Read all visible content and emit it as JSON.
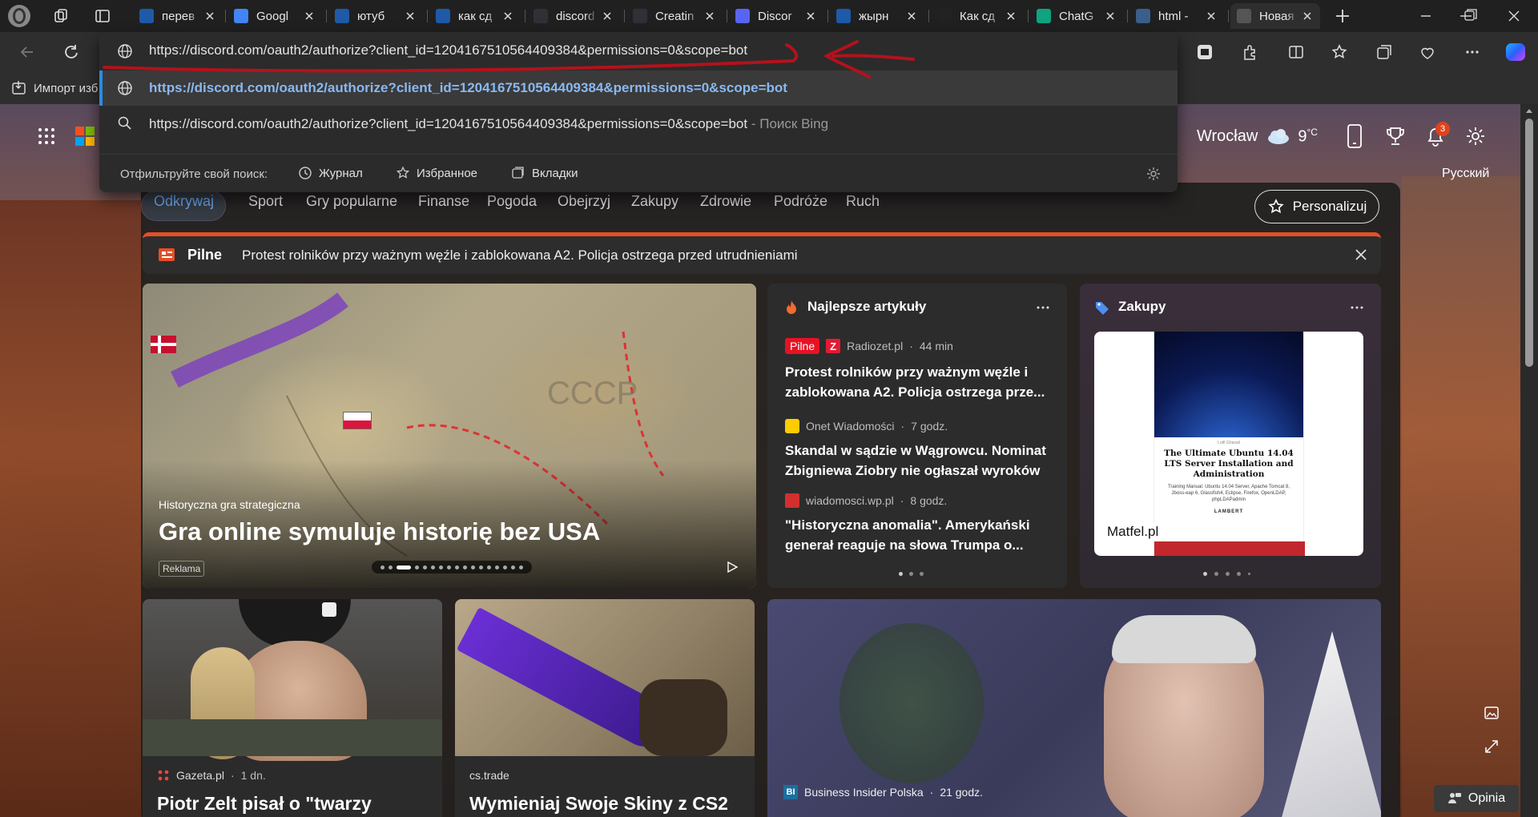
{
  "tabs": [
    {
      "label": "перев",
      "icon": "search-icon",
      "fav_color": "#1e5aa8"
    },
    {
      "label": "Googl",
      "icon": "google-translate-icon",
      "fav_color": "#4285f4"
    },
    {
      "label": "ютуб",
      "icon": "search-icon",
      "fav_color": "#1e5aa8"
    },
    {
      "label": "как сд",
      "icon": "search-icon",
      "fav_color": "#1e5aa8"
    },
    {
      "label": "discord",
      "icon": "discord-js-icon",
      "fav_color": "#2f3136"
    },
    {
      "label": "Creatin",
      "icon": "discord-js-icon",
      "fav_color": "#2f3136"
    },
    {
      "label": "Discor",
      "icon": "discord-icon",
      "fav_color": "#5865f2"
    },
    {
      "label": "жырн",
      "icon": "search-icon",
      "fav_color": "#1e5aa8"
    },
    {
      "label": "Как сд",
      "icon": "d-logo-icon",
      "fav_color": "#222"
    },
    {
      "label": "ChatG",
      "icon": "chatgpt-icon",
      "fav_color": "#10a37f"
    },
    {
      "label": "html -",
      "icon": "stackoverflow-icon",
      "fav_color": "#3a5f8a"
    },
    {
      "label": "Новая",
      "icon": "new-tab-icon",
      "fav_color": "#555"
    }
  ],
  "omnibox": {
    "url": "https://discord.com/oauth2/authorize?client_id=1204167510564409384&permissions=0&scope=bot",
    "suggestion_url": "https://discord.com/oauth2/authorize?client_id=1204167510564409384&permissions=0&scope=bot",
    "search_text": "https://discord.com/oauth2/authorize?client_id=1204167510564409384&permissions=0&scope=bot",
    "search_suffix": " - Поиск Bing",
    "filter_label": "Отфильтруйте свой поиск:",
    "filters": [
      "Журнал",
      "Избранное",
      "Вкладки"
    ]
  },
  "favorites_bar": {
    "import_label": "Импорт изб"
  },
  "header": {
    "city": "Wrocław",
    "temp": "9",
    "temp_unit": "°C",
    "notif_count": "3",
    "language": "Русский"
  },
  "nav": {
    "items": [
      "Odkrywaj",
      "Sport",
      "Gry popularne",
      "Finanse",
      "Pogoda",
      "Obejrzyj",
      "Zakupy",
      "Zdrowie",
      "Podróże",
      "Ruch"
    ],
    "personalize": "Personalizuj"
  },
  "breaking": {
    "label": "Pilne",
    "text": "Protest rolników przy ważnym węźle i zablokowana A2. Policja ostrzega przed utrudnieniami"
  },
  "hero": {
    "category": "Historyczna gra strategiczna",
    "title": "Gra online symuluje historię bez USA",
    "ad": "Reklama"
  },
  "top_articles": {
    "title": "Najlepsze artykuły",
    "items": [
      {
        "badge": "Pilne",
        "source": "Radiozet.pl",
        "time": "44 min",
        "headline": "Protest rolników przy ważnym węźle i zablokowana A2. Policja ostrzega prze..."
      },
      {
        "source": "Onet Wiadomości",
        "time": "7 godz.",
        "headline": "Skandal w sądzie w Wągrowcu. Nominat Zbigniewa Ziobry nie ogłaszał wyroków"
      },
      {
        "source": "wiadomosci.wp.pl",
        "time": "8 godz.",
        "headline": "\"Historyczna anomalia\". Amerykański generał reaguje na słowa Trumpa o..."
      }
    ]
  },
  "shopping": {
    "title": "Zakupy",
    "book_title": "The Ultimate Ubuntu 14.04 LTS Server Installation and Administration",
    "book_sub": "Training Manual: Ubuntu 14.04 Server, Apache Tomcat 8, Jboss-eap 6, Glassfish4, Eclipse, Firefox, OpenLDAP, phpLDAPadmin",
    "book_publisher": "LAMBERT",
    "book_author": "Lotfi Ghazali",
    "store": "Matfel.pl"
  },
  "bottom_cards": [
    {
      "source": "Gazeta.pl",
      "time": "1 dn.",
      "headline": "Piotr Zelt pisał o \"twarzy"
    },
    {
      "source": "cs.trade",
      "headline": "Wymieniaj Swoje Skiny z CS2"
    },
    {
      "source": "Business Insider Polska",
      "time": "21 godz."
    }
  ],
  "feedback": "Opinia",
  "colors": {
    "accent": "#2b8ae3",
    "breaking_red": "#e74c3c",
    "annotation_red": "#b3121c"
  }
}
